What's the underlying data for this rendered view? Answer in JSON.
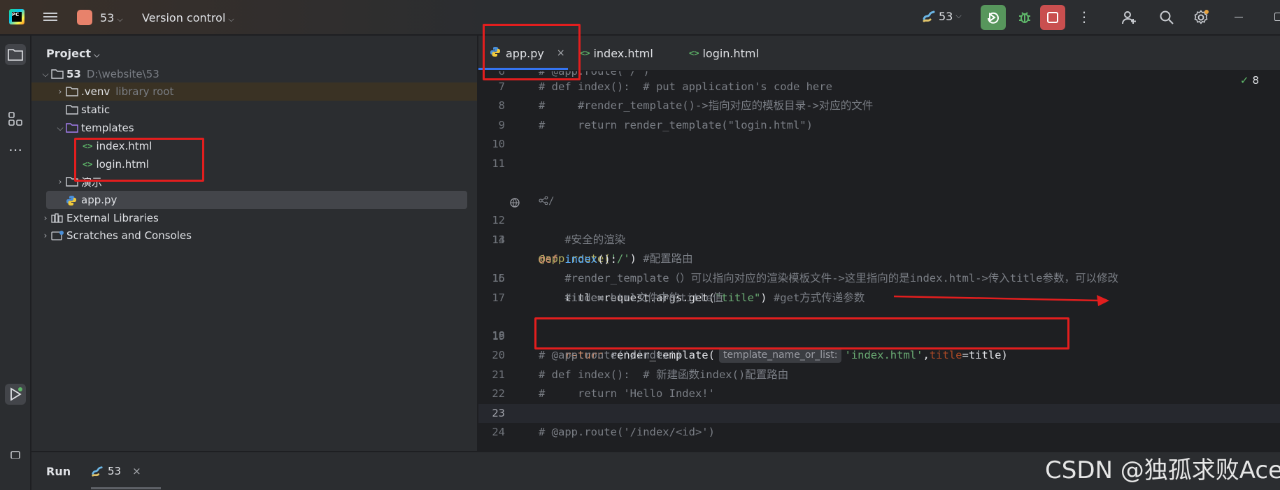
{
  "titlebar": {
    "project_name": "53",
    "version_control": "Version control",
    "run_config": "53"
  },
  "project_panel": {
    "title": "Project",
    "tree": [
      {
        "label": "53",
        "hint": "D:\\website\\53"
      },
      {
        "label": ".venv",
        "hint": "library root"
      },
      {
        "label": "static"
      },
      {
        "label": "templates"
      },
      {
        "label": "index.html"
      },
      {
        "label": "login.html"
      },
      {
        "label": "演示"
      },
      {
        "label": "app.py"
      },
      {
        "label": "External Libraries"
      },
      {
        "label": "Scratches and Consoles"
      }
    ]
  },
  "tabs": [
    {
      "label": "app.py",
      "close": "×"
    },
    {
      "label": "index.html"
    },
    {
      "label": "login.html"
    }
  ],
  "editor": {
    "checks": "8",
    "usages": "/",
    "param_hint": "template_name_or_list:",
    "lines": [
      {
        "n": "6",
        "code": "# @app.route('/')"
      },
      {
        "n": "7",
        "code": "# def index():  # put application's code here"
      },
      {
        "n": "8",
        "code": "#     #render_template()->指向对应的模板目录->对应的文件"
      },
      {
        "n": "9",
        "code": "#     return render_template(\"login.html\")"
      },
      {
        "n": "10",
        "code": ""
      },
      {
        "n": "11",
        "code": ""
      },
      {
        "n": "12",
        "dec": "@app.route(",
        "str": "'/'",
        "tail": ")",
        "cm": " #配置路由"
      },
      {
        "n": "13",
        "kw": "def ",
        "fn": "index",
        "tail": "():"
      },
      {
        "n": "14",
        "code": "    #安全的渲染"
      },
      {
        "n": "15",
        "pre": "    title=request.args.get(",
        "str": "\"title\"",
        "tail": ")",
        "cm": " #get方式传递参数"
      },
      {
        "n": "16",
        "code": "    #render_template（）可以指向对应的渲染模板文件->这里指向的是index.html->传入title参数，可以修改"
      },
      {
        "n": "17",
        "code": "    #index.html文件中的title值"
      },
      {
        "n": "18",
        "kw": "    return ",
        "pre": "render_template(",
        "str": "'index.html'",
        "comma": ",",
        "par": "title",
        "tail": "=title)"
      },
      {
        "n": "19",
        "code": ""
      },
      {
        "n": "20",
        "code": "# @app.route('/index')"
      },
      {
        "n": "21",
        "code": "# def index():  # 新建函数index()配置路由"
      },
      {
        "n": "22",
        "code": "#     return 'Hello Index!'"
      },
      {
        "n": "23",
        "code": ""
      },
      {
        "n": "24",
        "code": "# @app.route('/index/<id>')"
      }
    ]
  },
  "run_bar": {
    "title": "Run",
    "tab": "53",
    "close": "×"
  },
  "watermark": "CSDN @独孤求败Ace",
  "colors": {
    "annotation_red": "#e21e1e",
    "run_green": "#57965c",
    "stop_red": "#c94f4f",
    "accent_blue": "#3574f0"
  }
}
